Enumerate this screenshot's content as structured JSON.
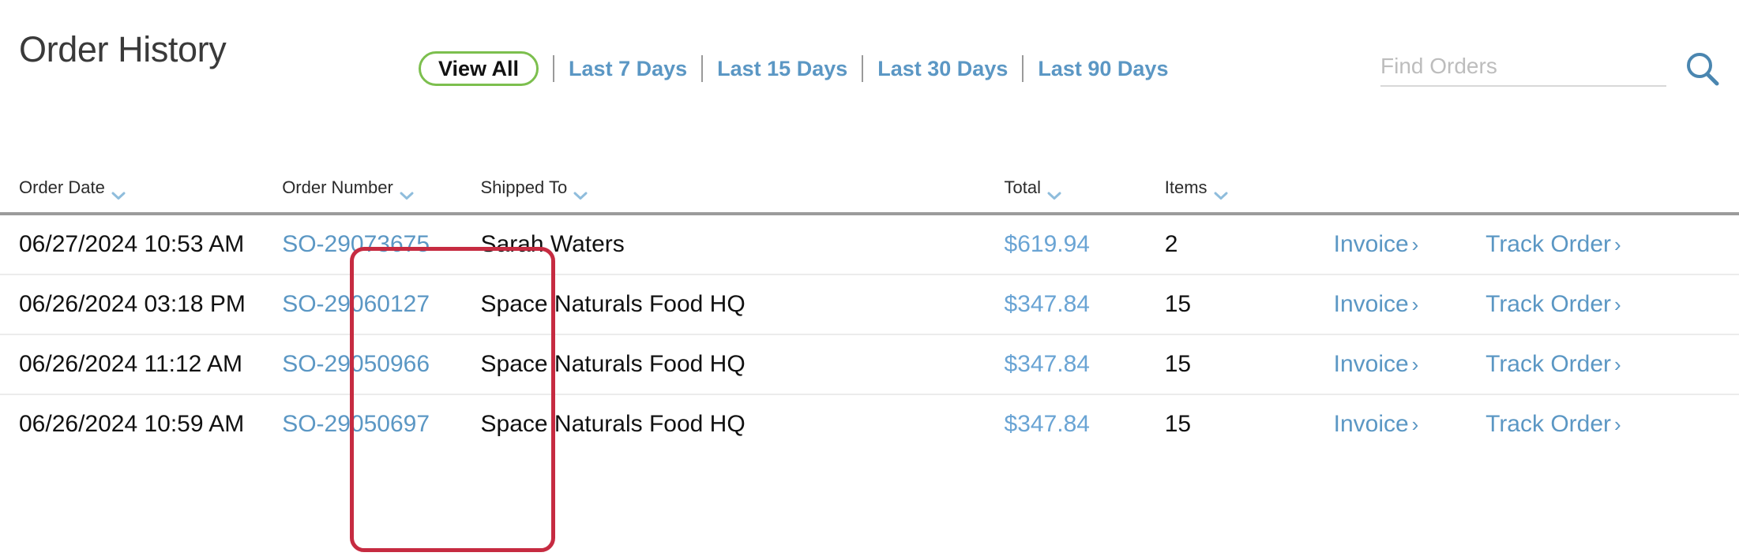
{
  "header": {
    "title": "Order History",
    "filters": [
      {
        "label": "View All",
        "active": true,
        "name": "filter-view-all"
      },
      {
        "label": "Last 7 Days",
        "active": false,
        "name": "filter-last-7-days"
      },
      {
        "label": "Last 15 Days",
        "active": false,
        "name": "filter-last-15-days"
      },
      {
        "label": "Last 30 Days",
        "active": false,
        "name": "filter-last-30-days"
      },
      {
        "label": "Last 90 Days",
        "active": false,
        "name": "filter-last-90-days"
      }
    ],
    "search": {
      "placeholder": "Find Orders",
      "value": "",
      "icon": "search-icon"
    }
  },
  "table": {
    "columns": [
      {
        "label": "Order Date",
        "sortable": true,
        "icon": "chevron-down-icon"
      },
      {
        "label": "Order Number",
        "sortable": true,
        "icon": "chevron-down-icon"
      },
      {
        "label": "Shipped To",
        "sortable": true,
        "icon": "chevron-down-icon"
      },
      {
        "label": "Total",
        "sortable": true,
        "icon": "chevron-down-icon"
      },
      {
        "label": "Items",
        "sortable": true,
        "icon": "chevron-down-icon"
      },
      {
        "label": "",
        "sortable": false,
        "icon": ""
      },
      {
        "label": "",
        "sortable": false,
        "icon": ""
      }
    ],
    "row_actions": {
      "invoice_label": "Invoice",
      "track_label": "Track Order",
      "chevron": "›"
    },
    "rows": [
      {
        "order_date": "06/27/2024 10:53 AM",
        "order_number": "SO-29073675",
        "shipped_to": "Sarah Waters",
        "total": "$619.94",
        "items": "2"
      },
      {
        "order_date": "06/26/2024 03:18 PM",
        "order_number": "SO-29060127",
        "shipped_to": "Space Naturals Food HQ",
        "total": "$347.84",
        "items": "15"
      },
      {
        "order_date": "06/26/2024 11:12 AM",
        "order_number": "SO-29050966",
        "shipped_to": "Space Naturals Food HQ",
        "total": "$347.84",
        "items": "15"
      },
      {
        "order_date": "06/26/2024 10:59 AM",
        "order_number": "SO-29050697",
        "shipped_to": "Space Naturals Food HQ",
        "total": "$347.84",
        "items": "15"
      }
    ]
  },
  "annotation": {
    "target": "order-number-column",
    "color": "#c62b41"
  },
  "colors": {
    "link_blue": "#5b97c4",
    "total_blue": "#6aa4d4",
    "pill_green": "#7cbf4e",
    "annotation_red": "#c62b41",
    "header_rule": "#9b9b9b",
    "row_rule": "#ececec"
  }
}
